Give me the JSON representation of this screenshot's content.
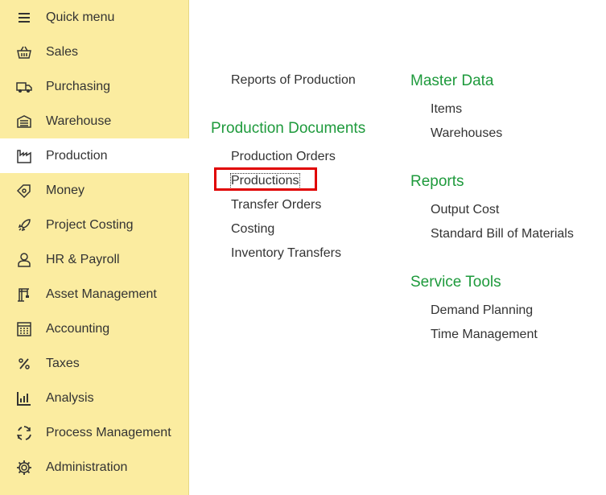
{
  "sidebar": {
    "items": [
      {
        "label": "Quick menu",
        "icon": "hamburger-icon"
      },
      {
        "label": "Sales",
        "icon": "basket-icon"
      },
      {
        "label": "Purchasing",
        "icon": "truck-icon"
      },
      {
        "label": "Warehouse",
        "icon": "warehouse-icon"
      },
      {
        "label": "Production",
        "icon": "factory-icon",
        "active": true
      },
      {
        "label": "Money",
        "icon": "money-tag-icon"
      },
      {
        "label": "Project Costing",
        "icon": "rocket-icon"
      },
      {
        "label": "HR & Payroll",
        "icon": "person-icon"
      },
      {
        "label": "Asset Management",
        "icon": "crane-icon"
      },
      {
        "label": "Accounting",
        "icon": "calculator-icon"
      },
      {
        "label": "Taxes",
        "icon": "percent-icon"
      },
      {
        "label": "Analysis",
        "icon": "bar-chart-icon"
      },
      {
        "label": "Process Management",
        "icon": "cycle-icon"
      },
      {
        "label": "Administration",
        "icon": "gear-icon"
      }
    ]
  },
  "main": {
    "left_column": {
      "top_link": "Reports of Production",
      "production_documents": {
        "title": "Production Documents",
        "links": [
          "Production Orders",
          "Productions",
          "Transfer Orders",
          "Costing",
          "Inventory Transfers"
        ]
      }
    },
    "right_column": {
      "master_data": {
        "title": "Master Data",
        "links": [
          "Items",
          "Warehouses"
        ]
      },
      "reports": {
        "title": "Reports",
        "links": [
          "Output Cost",
          "Standard Bill of Materials"
        ]
      },
      "service_tools": {
        "title": "Service Tools",
        "links": [
          "Demand Planning",
          "Time Management"
        ]
      }
    }
  },
  "colors": {
    "sidebar_bg": "#fbeca0",
    "section_title": "#1e9a3c",
    "highlight": "#e00000"
  }
}
